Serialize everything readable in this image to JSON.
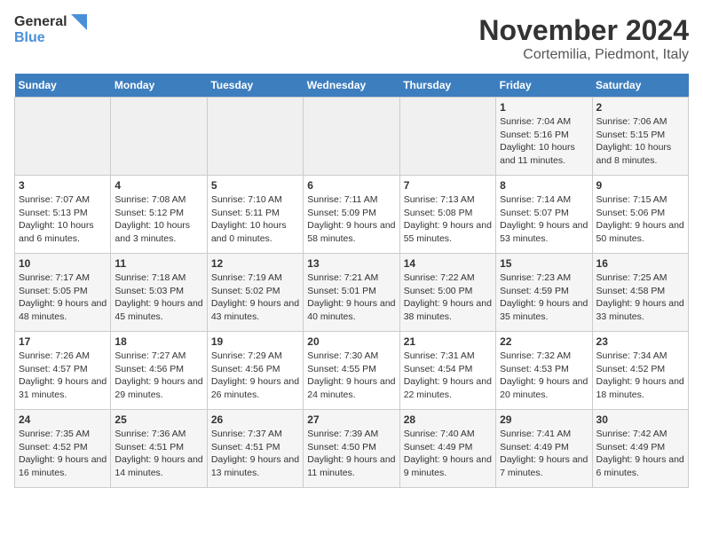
{
  "logo": {
    "line1": "General",
    "line2": "Blue"
  },
  "title": "November 2024",
  "subtitle": "Cortemilia, Piedmont, Italy",
  "days_of_week": [
    "Sunday",
    "Monday",
    "Tuesday",
    "Wednesday",
    "Thursday",
    "Friday",
    "Saturday"
  ],
  "weeks": [
    [
      {
        "day": "",
        "info": ""
      },
      {
        "day": "",
        "info": ""
      },
      {
        "day": "",
        "info": ""
      },
      {
        "day": "",
        "info": ""
      },
      {
        "day": "",
        "info": ""
      },
      {
        "day": "1",
        "info": "Sunrise: 7:04 AM\nSunset: 5:16 PM\nDaylight: 10 hours and 11 minutes."
      },
      {
        "day": "2",
        "info": "Sunrise: 7:06 AM\nSunset: 5:15 PM\nDaylight: 10 hours and 8 minutes."
      }
    ],
    [
      {
        "day": "3",
        "info": "Sunrise: 7:07 AM\nSunset: 5:13 PM\nDaylight: 10 hours and 6 minutes."
      },
      {
        "day": "4",
        "info": "Sunrise: 7:08 AM\nSunset: 5:12 PM\nDaylight: 10 hours and 3 minutes."
      },
      {
        "day": "5",
        "info": "Sunrise: 7:10 AM\nSunset: 5:11 PM\nDaylight: 10 hours and 0 minutes."
      },
      {
        "day": "6",
        "info": "Sunrise: 7:11 AM\nSunset: 5:09 PM\nDaylight: 9 hours and 58 minutes."
      },
      {
        "day": "7",
        "info": "Sunrise: 7:13 AM\nSunset: 5:08 PM\nDaylight: 9 hours and 55 minutes."
      },
      {
        "day": "8",
        "info": "Sunrise: 7:14 AM\nSunset: 5:07 PM\nDaylight: 9 hours and 53 minutes."
      },
      {
        "day": "9",
        "info": "Sunrise: 7:15 AM\nSunset: 5:06 PM\nDaylight: 9 hours and 50 minutes."
      }
    ],
    [
      {
        "day": "10",
        "info": "Sunrise: 7:17 AM\nSunset: 5:05 PM\nDaylight: 9 hours and 48 minutes."
      },
      {
        "day": "11",
        "info": "Sunrise: 7:18 AM\nSunset: 5:03 PM\nDaylight: 9 hours and 45 minutes."
      },
      {
        "day": "12",
        "info": "Sunrise: 7:19 AM\nSunset: 5:02 PM\nDaylight: 9 hours and 43 minutes."
      },
      {
        "day": "13",
        "info": "Sunrise: 7:21 AM\nSunset: 5:01 PM\nDaylight: 9 hours and 40 minutes."
      },
      {
        "day": "14",
        "info": "Sunrise: 7:22 AM\nSunset: 5:00 PM\nDaylight: 9 hours and 38 minutes."
      },
      {
        "day": "15",
        "info": "Sunrise: 7:23 AM\nSunset: 4:59 PM\nDaylight: 9 hours and 35 minutes."
      },
      {
        "day": "16",
        "info": "Sunrise: 7:25 AM\nSunset: 4:58 PM\nDaylight: 9 hours and 33 minutes."
      }
    ],
    [
      {
        "day": "17",
        "info": "Sunrise: 7:26 AM\nSunset: 4:57 PM\nDaylight: 9 hours and 31 minutes."
      },
      {
        "day": "18",
        "info": "Sunrise: 7:27 AM\nSunset: 4:56 PM\nDaylight: 9 hours and 29 minutes."
      },
      {
        "day": "19",
        "info": "Sunrise: 7:29 AM\nSunset: 4:56 PM\nDaylight: 9 hours and 26 minutes."
      },
      {
        "day": "20",
        "info": "Sunrise: 7:30 AM\nSunset: 4:55 PM\nDaylight: 9 hours and 24 minutes."
      },
      {
        "day": "21",
        "info": "Sunrise: 7:31 AM\nSunset: 4:54 PM\nDaylight: 9 hours and 22 minutes."
      },
      {
        "day": "22",
        "info": "Sunrise: 7:32 AM\nSunset: 4:53 PM\nDaylight: 9 hours and 20 minutes."
      },
      {
        "day": "23",
        "info": "Sunrise: 7:34 AM\nSunset: 4:52 PM\nDaylight: 9 hours and 18 minutes."
      }
    ],
    [
      {
        "day": "24",
        "info": "Sunrise: 7:35 AM\nSunset: 4:52 PM\nDaylight: 9 hours and 16 minutes."
      },
      {
        "day": "25",
        "info": "Sunrise: 7:36 AM\nSunset: 4:51 PM\nDaylight: 9 hours and 14 minutes."
      },
      {
        "day": "26",
        "info": "Sunrise: 7:37 AM\nSunset: 4:51 PM\nDaylight: 9 hours and 13 minutes."
      },
      {
        "day": "27",
        "info": "Sunrise: 7:39 AM\nSunset: 4:50 PM\nDaylight: 9 hours and 11 minutes."
      },
      {
        "day": "28",
        "info": "Sunrise: 7:40 AM\nSunset: 4:49 PM\nDaylight: 9 hours and 9 minutes."
      },
      {
        "day": "29",
        "info": "Sunrise: 7:41 AM\nSunset: 4:49 PM\nDaylight: 9 hours and 7 minutes."
      },
      {
        "day": "30",
        "info": "Sunrise: 7:42 AM\nSunset: 4:49 PM\nDaylight: 9 hours and 6 minutes."
      }
    ]
  ]
}
